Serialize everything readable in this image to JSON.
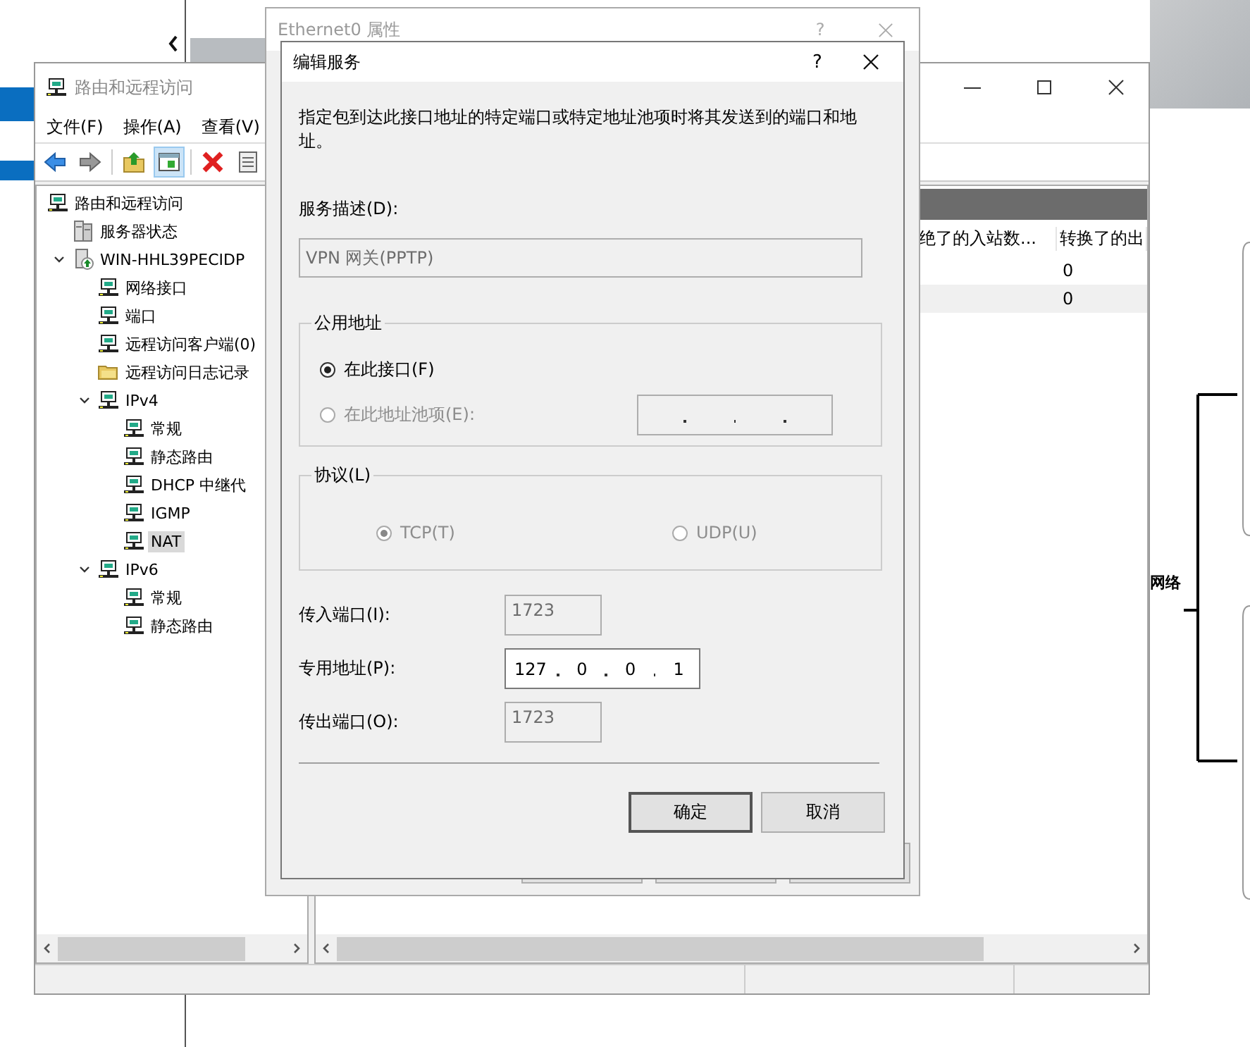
{
  "desktop": {
    "diagram_label": "网络"
  },
  "main_window": {
    "title": "路由和远程访问",
    "menu": [
      "文件(F)",
      "操作(A)",
      "查看(V)"
    ],
    "tree": [
      {
        "label": "路由和远程访问",
        "kind": "computer",
        "selected": false,
        "children": [
          {
            "label": "服务器状态",
            "kind": "servers",
            "selected": false
          },
          {
            "label": "WIN-HHL39PECIDP",
            "kind": "server",
            "selected": false,
            "expanded": true,
            "children": [
              {
                "label": "网络接口",
                "kind": "computer",
                "selected": false
              },
              {
                "label": "端口",
                "kind": "computer",
                "selected": false
              },
              {
                "label": "远程访问客户端(0)",
                "kind": "computer",
                "selected": false
              },
              {
                "label": "远程访问日志记录",
                "kind": "folder",
                "selected": false
              },
              {
                "label": "IPv4",
                "kind": "computer",
                "selected": false,
                "expanded": true,
                "children": [
                  {
                    "label": "常规",
                    "kind": "computer",
                    "selected": false
                  },
                  {
                    "label": "静态路由",
                    "kind": "computer",
                    "selected": false
                  },
                  {
                    "label": "DHCP 中继代",
                    "kind": "computer",
                    "selected": false
                  },
                  {
                    "label": "IGMP",
                    "kind": "computer",
                    "selected": false
                  },
                  {
                    "label": "NAT",
                    "kind": "computer",
                    "selected": true
                  }
                ]
              },
              {
                "label": "IPv6",
                "kind": "computer",
                "selected": false,
                "expanded": true,
                "children": [
                  {
                    "label": "常规",
                    "kind": "computer",
                    "selected": false
                  },
                  {
                    "label": "静态路由",
                    "kind": "computer",
                    "selected": false
                  }
                ]
              }
            ]
          }
        ]
      }
    ],
    "list": {
      "columns": [
        "绝了的入站数...",
        "转换了的出"
      ],
      "rows": [
        {
          "column_2": "0"
        },
        {
          "column_2": "0"
        }
      ]
    }
  },
  "properties_window": {
    "title": "Ethernet0 属性",
    "help": "?"
  },
  "dialog": {
    "title": "编辑服务",
    "help": "?",
    "description": "指定包到达此接口地址的特定端口或特定地址池项时将其发送到的端口和地址。",
    "service": {
      "label": "服务描述(D):",
      "value": "VPN 网关(PPTP)",
      "disabled": true
    },
    "public_address": {
      "legend": "公用地址",
      "options": [
        {
          "label": "在此接口(F)",
          "selected": true,
          "disabled": false
        },
        {
          "label": "在此地址池项(E):",
          "selected": false,
          "disabled": true
        }
      ]
    },
    "protocol": {
      "legend": "协议(L)",
      "options": [
        {
          "label": "TCP(T)",
          "selected": true,
          "disabled": true
        },
        {
          "label": "UDP(U)",
          "selected": false,
          "disabled": true
        }
      ]
    },
    "fields": [
      {
        "kind": "port",
        "label": "传入端口(I):",
        "value": "1723",
        "disabled": true
      },
      {
        "kind": "ip",
        "label": "专用地址(P):",
        "octets": [
          "127",
          "0",
          "0",
          "1"
        ],
        "disabled": false
      },
      {
        "kind": "port",
        "label": "传出端口(O):",
        "value": "1723",
        "disabled": true
      }
    ],
    "buttons": [
      {
        "label": "确定",
        "default": true
      },
      {
        "label": "取消",
        "default": false
      }
    ]
  }
}
